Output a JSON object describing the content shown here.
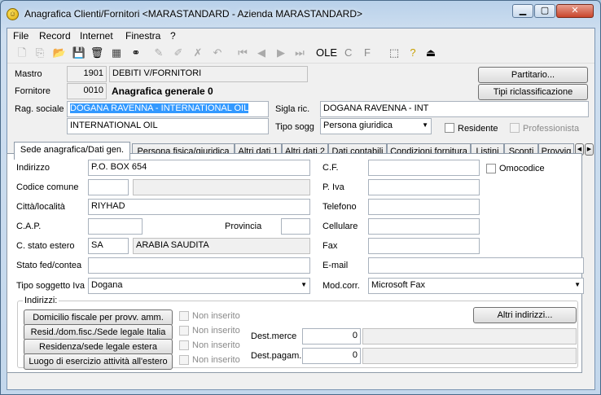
{
  "window": {
    "title": "Anagrafica Clienti/Fornitori <MARASTANDARD - Azienda MARASTANDARD>",
    "controls": {
      "minimize": "▁",
      "maximize": "▢",
      "close": "✕"
    }
  },
  "menu": [
    "File",
    "Record",
    "Internet",
    "Finestra",
    "?"
  ],
  "toolbar": {
    "labels": {
      "ole": "OLE",
      "c": "C",
      "f": "F"
    }
  },
  "header": {
    "mastro_label": "Mastro",
    "mastro_code": "1901",
    "mastro_desc": "DEBITI V/FORNITORI",
    "fornitore_label": "Fornitore",
    "fornitore_code": "0010",
    "fornitore_desc": "Anagrafica generale 0",
    "ragsoc_label": "Rag. sociale",
    "ragsoc_1": "DOGANA RAVENNA - INTERNATIONAL OIL",
    "ragsoc_2": "INTERNATIONAL OIL",
    "sigla_label": "Sigla ric.",
    "sigla_value": "DOGANA RAVENNA - INT",
    "tiposogg_label": "Tipo sogg",
    "tiposogg_value": "Persona giuridica",
    "residente_label": "Residente",
    "professionista_label": "Professionista",
    "partitario_button": "Partitario...",
    "riclass_button": "Tipi riclassificazione"
  },
  "tabs": [
    "Sede anagrafica/Dati gen.",
    "Persona fisica/giuridica",
    "Altri dati 1",
    "Altri dati 2",
    "Dati contabili",
    "Condizioni fornitura",
    "Listini",
    "Sconti",
    "Provvig"
  ],
  "form": {
    "indirizzo_label": "Indirizzo",
    "indirizzo": "P.O. BOX 654",
    "codcomune_label": "Codice comune",
    "codcomune": "",
    "codcomune_desc": "",
    "citta_label": "Città/località",
    "citta": "RIYHAD",
    "cap_label": "C.A.P.",
    "cap": "",
    "provincia_label": "Provincia",
    "provincia": "",
    "stato_label": "C. stato estero",
    "stato_code": "SA",
    "stato_desc": "ARABIA SAUDITA",
    "statofed_label": "Stato fed/contea",
    "statofed": "",
    "tipoiva_label": "Tipo soggetto Iva",
    "tipoiva": "Dogana",
    "cf_label": "C.F.",
    "cf": "",
    "omocodice_label": "Omocodice",
    "piva_label": "P. Iva",
    "piva": "",
    "telefono_label": "Telefono",
    "telefono": "",
    "cellulare_label": "Cellulare",
    "cellulare": "",
    "fax_label": "Fax",
    "fax": "",
    "email_label": "E-mail",
    "email": "",
    "modcorr_label": "Mod.corr.",
    "modcorr": "Microsoft Fax"
  },
  "indirizzi": {
    "label": "Indirizzi:",
    "buttons": [
      "Domicilio fiscale per provv. amm.",
      "Resid./dom.fisc./Sede legale Italia",
      "Residenza/sede legale estera",
      "Luogo di esercizio attività all'estero"
    ],
    "non_inserito": "Non inserito",
    "altri_button": "Altri indirizzi...",
    "destmerce_label": "Dest.merce",
    "destmerce_value": "0",
    "destpagam_label": "Dest.pagam.",
    "destpagam_value": "0"
  }
}
